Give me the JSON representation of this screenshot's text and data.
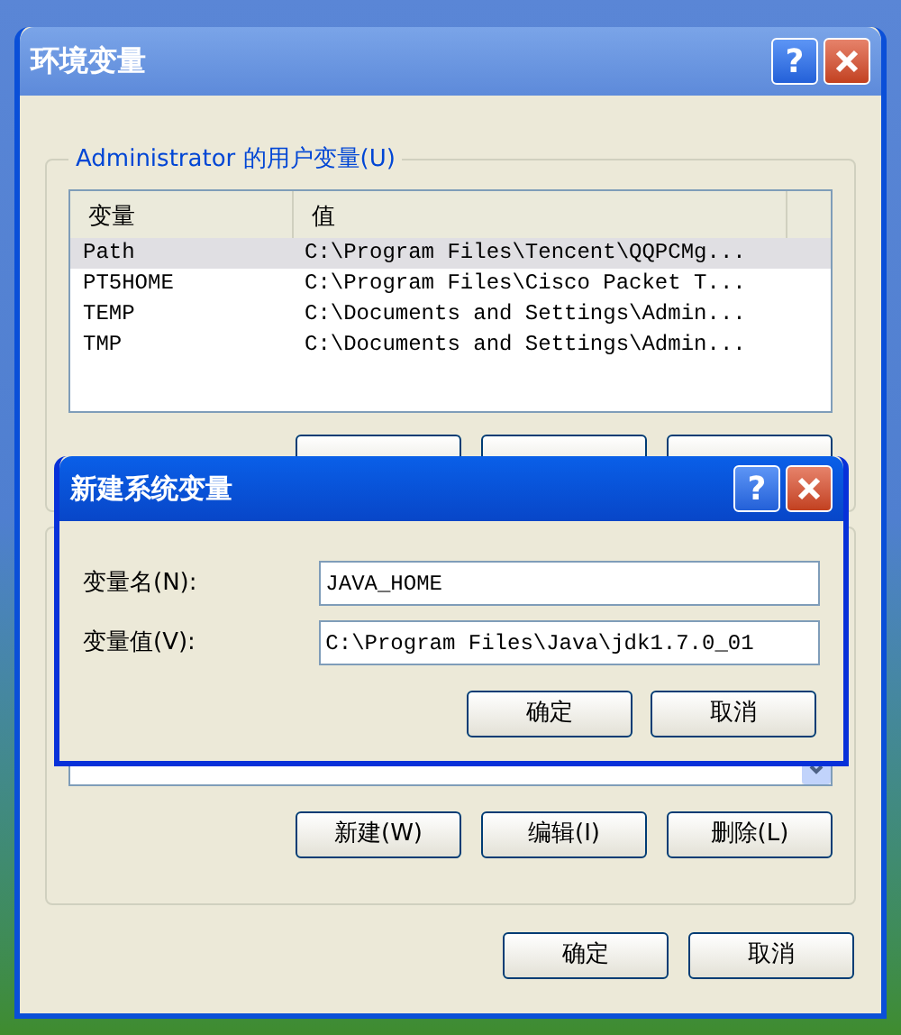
{
  "window": {
    "title": "环境变量",
    "help": "?"
  },
  "user_vars": {
    "legend": "Administrator 的用户变量(U)",
    "columns": [
      "变量",
      "值"
    ],
    "rows": [
      {
        "name": "Path",
        "value": "C:\\Program Files\\Tencent\\QQPCMg...",
        "selected": true
      },
      {
        "name": "PT5HOME",
        "value": "C:\\Program Files\\Cisco Packet T...",
        "selected": false
      },
      {
        "name": "TEMP",
        "value": "C:\\Documents and Settings\\Admin...",
        "selected": false
      },
      {
        "name": "TMP",
        "value": "C:\\Documents and Settings\\Admin...",
        "selected": false
      }
    ]
  },
  "system_vars": {
    "buttons": [
      "新建(W)",
      "编辑(I)",
      "删除(L)"
    ]
  },
  "buttons": [
    "确定",
    "取消"
  ],
  "dialog": {
    "title": "新建系统变量",
    "help": "?",
    "fields": [
      {
        "label": "变量名(N):",
        "value": "JAVA_HOME"
      },
      {
        "label": "变量值(V):",
        "value": "C:\\Program Files\\Java\\jdk1.7.0_01"
      }
    ],
    "buttons": [
      "确定",
      "取消"
    ]
  }
}
